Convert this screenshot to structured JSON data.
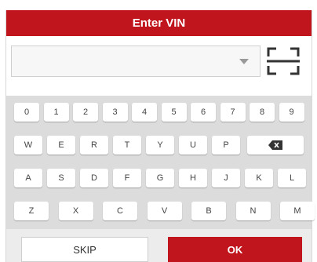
{
  "colors": {
    "accent": "#c0151c",
    "keyboard_bg": "#dcdcdc",
    "key_bg": "#ffffff"
  },
  "dialog": {
    "title": "Enter VIN"
  },
  "vin_field": {
    "value": "",
    "icon": "chevron-down-icon"
  },
  "scan": {
    "icon": "scan-frame-icon"
  },
  "keyboard": {
    "row1": [
      "0",
      "1",
      "2",
      "3",
      "4",
      "5",
      "6",
      "7",
      "8",
      "9"
    ],
    "row2": [
      "W",
      "E",
      "R",
      "T",
      "Y",
      "U",
      "P"
    ],
    "row3": [
      "A",
      "S",
      "D",
      "F",
      "G",
      "H",
      "J",
      "K",
      "L"
    ],
    "row4": [
      "Z",
      "X",
      "C",
      "V",
      "B",
      "N",
      "M"
    ],
    "backspace_icon": "backspace-icon"
  },
  "buttons": {
    "skip": "SKIP",
    "ok": "OK"
  }
}
